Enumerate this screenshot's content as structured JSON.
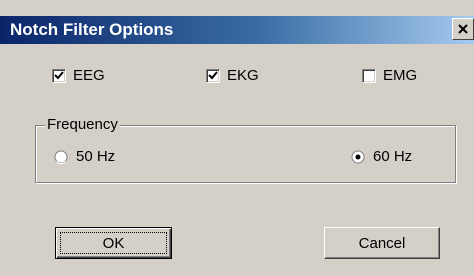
{
  "window": {
    "title": "Notch Filter Options",
    "close_glyph": "✕"
  },
  "checkboxes": [
    {
      "label": "EEG",
      "checked": true
    },
    {
      "label": "EKG",
      "checked": true
    },
    {
      "label": "EMG",
      "checked": false
    }
  ],
  "frequency": {
    "group_label": "Frequency",
    "options": [
      {
        "label": "50 Hz",
        "selected": false
      },
      {
        "label": "60 Hz",
        "selected": true
      }
    ]
  },
  "buttons": {
    "ok_label": "OK",
    "cancel_label": "Cancel"
  },
  "colors": {
    "titlebar_start": "#0a246a",
    "titlebar_end": "#a6caf0",
    "face": "#d4d0c8"
  },
  "icons": {
    "close": "close-icon",
    "checkmark": "checkmark-icon",
    "radio": "radio-icon"
  }
}
